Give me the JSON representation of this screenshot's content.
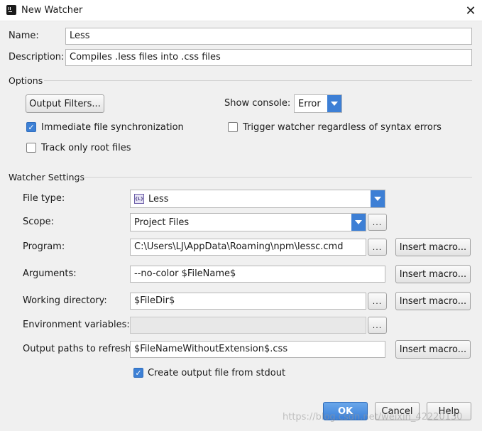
{
  "window": {
    "title": "New Watcher"
  },
  "name": {
    "label": "Name:",
    "value": "Less"
  },
  "description": {
    "label": "Description:",
    "value": "Compiles .less files into .css files"
  },
  "options": {
    "section_label": "Options",
    "output_filters_button": "Output Filters...",
    "show_console_label": "Show console:",
    "show_console_value": "Error",
    "immediate_sync": {
      "label": "Immediate file synchronization",
      "checked": true
    },
    "trigger_regardless": {
      "label": "Trigger watcher regardless of syntax errors",
      "checked": false
    },
    "track_root": {
      "label": "Track only root files",
      "checked": false
    }
  },
  "watcher_settings": {
    "section_label": "Watcher Settings",
    "file_type": {
      "label": "File type:",
      "value": "Less",
      "icon": "less-file-icon",
      "icon_text": "{L}"
    },
    "scope": {
      "label": "Scope:",
      "value": "Project Files"
    },
    "program": {
      "label": "Program:",
      "value": "C:\\Users\\LJ\\AppData\\Roaming\\npm\\lessc.cmd"
    },
    "arguments": {
      "label": "Arguments:",
      "value": "--no-color $FileName$"
    },
    "working_directory": {
      "label": "Working directory:",
      "value": "$FileDir$"
    },
    "environment_variables": {
      "label": "Environment variables:",
      "value": ""
    },
    "output_paths": {
      "label": "Output paths to refresh:",
      "value": "$FileNameWithoutExtension$.css"
    },
    "insert_macro_label": "Insert macro...",
    "browse_label": "...",
    "create_output": {
      "label": "Create output file from stdout",
      "checked": true
    }
  },
  "footer": {
    "ok": "OK",
    "cancel": "Cancel",
    "help": "Help"
  },
  "watermark": "https://blog.csdn.net/weixin_42220130",
  "colors": {
    "accent": "#3d7fd5",
    "background": "#f0f0f0"
  }
}
